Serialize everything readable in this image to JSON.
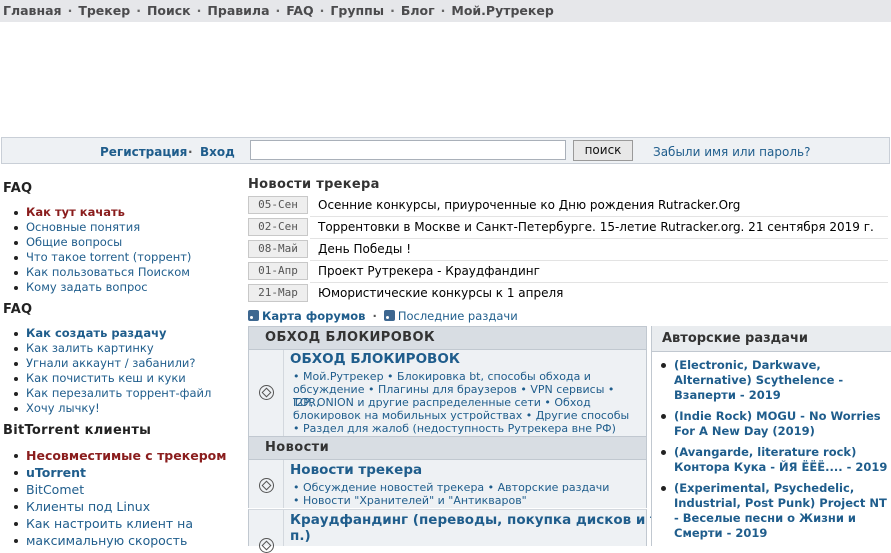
{
  "topnav": {
    "items": [
      "Главная",
      "Трекер",
      "Поиск",
      "Правила",
      "FAQ",
      "Группы",
      "Блог",
      "Мой.Рутрекер"
    ]
  },
  "login": {
    "register": "Регистрация",
    "login": "Вход",
    "search_button": "поиск",
    "forgot": "Забыли имя или пароль?"
  },
  "sidebar": {
    "faq1_title": "FAQ",
    "faq1": [
      "Как тут качать",
      "Основные понятия",
      "Общие вопросы",
      "Что такое torrent (торрент)",
      "Как пользоваться Поиском",
      "Кому задать вопрос"
    ],
    "faq2_title": "FAQ",
    "faq2": [
      "Как создать раздачу",
      "Как залить картинку",
      "Угнали аккаунт / забанили?",
      "Как почистить кеш и куки",
      "Как перезалить торрент-файл",
      "Хочу лычку!"
    ],
    "bt_title": "BitTorrent клиенты",
    "bt": [
      "Несовместимые с трекером",
      "uTorrent",
      "BitComet",
      "Клиенты под Linux",
      "Как настроить клиент на",
      "максимальную скорость"
    ]
  },
  "news": {
    "title": "Новости трекера",
    "items": [
      {
        "date": "05-Сен",
        "text": "Осенние конкурсы, приуроченные ко Дню рождения Rutracker.Org"
      },
      {
        "date": "02-Сен",
        "text": "Торрентовки в Москве и Санкт-Петербурге. 15-летие Rutracker.org. 21 сентября 2019 г."
      },
      {
        "date": "08-Май",
        "text": "День Победы !"
      },
      {
        "date": "01-Апр",
        "text": "Проект Рутрекера - Краудфандинг"
      },
      {
        "date": "21-Мар",
        "text": "Юмористические конкурсы к 1 апреля"
      }
    ],
    "rss1": "Карта форумов",
    "rss2": "Последние раздачи"
  },
  "forums": {
    "cat1": "ОБХОД БЛОКИРОВОК",
    "f1_name": "ОБХОД БЛОКИРОВОК",
    "f1_sub1": "• Мой.Рутрекер • Блокировка bt, способы обхода и",
    "f1_sub2": "обсуждение • Плагины для браузеров • VPN сервисы • TOR,",
    "f1_sub3": "I2P, ONION и другие распределенные сети • Обход",
    "f1_sub4": "блокировок на мобильных устройствах • Другие способы",
    "f1_sub5": "• Раздел для жалоб (недоступность Рутрекера вне РФ)",
    "cat2": "Новости",
    "f2_name": "Новости трекера",
    "f2_sub1": "• Обсуждение новостей трекера • Авторские раздачи",
    "f2_sub2": "• Новости \"Хранителей\" и \"Антикваров\"",
    "f3_name1": "Краудфандинг (переводы, покупка дисков и т.",
    "f3_name2": "п.)"
  },
  "author": {
    "title": "Авторские раздачи",
    "items": [
      [
        "(Electronic, Darkwave,",
        "Alternative) Scythelence -",
        "Взаперти - 2019"
      ],
      [
        "(Indie Rock) MOGU - No Worries",
        "For A New Day (2019)"
      ],
      [
        "(Avangarde, literature rock)",
        "Контора Кука - ЙЯ ЁЁЁ.... - 2019"
      ],
      [
        "(Experimental, Psychedelic,",
        "Industrial, Post Punk) Project NT",
        "- Веселые песни о Жизни и",
        "Смерти - 2019"
      ]
    ]
  }
}
